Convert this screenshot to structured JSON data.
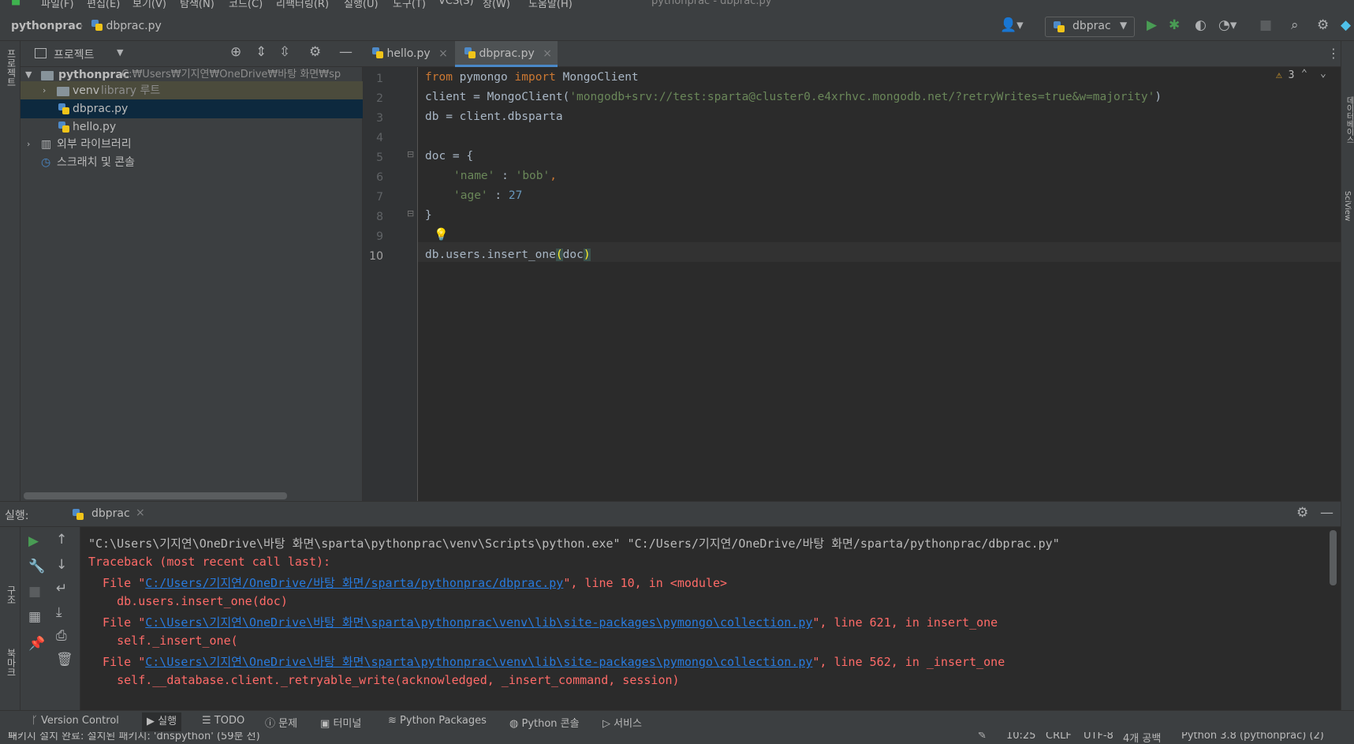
{
  "menubar": {
    "items": [
      "파일(F)",
      "편집(E)",
      "보기(V)",
      "탐색(N)",
      "코드(C)",
      "리팩터링(R)",
      "실행(U)",
      "도구(T)",
      "VCS(S)",
      "창(W)",
      "도움말(H)"
    ],
    "window_title": "pythonprac - dbprac.py"
  },
  "navbar": {
    "project": "pythonprac",
    "file": "dbprac.py",
    "run_config": "dbprac"
  },
  "project_panel": {
    "title": "프로젝트",
    "side_label": "프로젝트",
    "tree": [
      {
        "label": "pythonprac",
        "hint": "C:₩Users₩기지연₩OneDrive₩바탕 화면₩sp"
      },
      {
        "label": "venv",
        "hint": "library 루트"
      },
      {
        "label": "dbprac.py"
      },
      {
        "label": "hello.py"
      },
      {
        "label": "외부 라이브러리"
      },
      {
        "label": "스크래치 및 콘솔"
      }
    ]
  },
  "editor": {
    "tabs": [
      {
        "label": "hello.py"
      },
      {
        "label": "dbprac.py"
      }
    ],
    "warning_count": "3",
    "line_numbers": [
      "1",
      "2",
      "3",
      "4",
      "5",
      "6",
      "7",
      "8",
      "9",
      "10"
    ],
    "code": {
      "l1_kw1": "from",
      "l1_mod": " pymongo ",
      "l1_kw2": "import",
      "l1_name": " MongoClient",
      "l2_a": "client = MongoClient(",
      "l2_str": "'mongodb+srv://test:sparta@cluster0.e4xrhvc.mongodb.net/?retryWrites=true&w=majority'",
      "l2_b": ")",
      "l3": "db = client.dbsparta",
      "l5": "doc = {",
      "l6_key": "'name'",
      "l6_mid": " : ",
      "l6_val": "'bob'",
      "l6_end": ",",
      "l7_key": "'age'",
      "l7_mid": " : ",
      "l7_val": "27",
      "l8": "}",
      "l10_a": "db.users.insert_one",
      "l10_b": "(",
      "l10_c": "doc",
      "l10_d": ")"
    }
  },
  "run_panel": {
    "label": "실행:",
    "tab": "dbprac",
    "lines": {
      "cmd": "\"C:\\Users\\기지연\\OneDrive\\바탕 화면\\sparta\\pythonprac\\venv\\Scripts\\python.exe\" \"C:/Users/기지연/OneDrive/바탕 화면/sparta/pythonprac/dbprac.py\"",
      "tb": "Traceback (most recent call last):",
      "f1_pre": "  File \"",
      "f1_link": "C:/Users/기지연/OneDrive/바탕 화면/sparta/pythonprac/dbprac.py",
      "f1_post": "\", line 10, in <module>",
      "f1_code": "    db.users.insert_one(doc)",
      "f2_pre": "  File \"",
      "f2_link": "C:\\Users\\기지연\\OneDrive\\바탕 화면\\sparta\\pythonprac\\venv\\lib\\site-packages\\pymongo\\collection.py",
      "f2_post": "\", line 621, in insert_one",
      "f2_code": "    self._insert_one(",
      "f3_pre": "  File \"",
      "f3_link": "C:\\Users\\기지연\\OneDrive\\바탕 화면\\sparta\\pythonprac\\venv\\lib\\site-packages\\pymongo\\collection.py",
      "f3_post": "\", line 562, in _insert_one",
      "f3_code": "    self.__database.client._retryable_write(acknowledged, _insert_command, session)"
    },
    "side_labels": {
      "structure": "구조",
      "bookmarks": "북마크"
    }
  },
  "tool_tabs": [
    "Version Control",
    "실행",
    "TODO",
    "문제",
    "터미널",
    "Python Packages",
    "Python 콘솔",
    "서비스"
  ],
  "statusbar": {
    "message": "패키지 설치 완료: 설치된 패키지: 'dnspython' (59분 전)",
    "position": "10:25",
    "line_sep": "CRLF",
    "encoding": "UTF-8",
    "indent": "4개 공백",
    "interpreter": "Python 3.8 (pythonprac) (2)"
  },
  "right_strip": {
    "db_label": "데이터베이스",
    "sciview_label": "SciView"
  }
}
